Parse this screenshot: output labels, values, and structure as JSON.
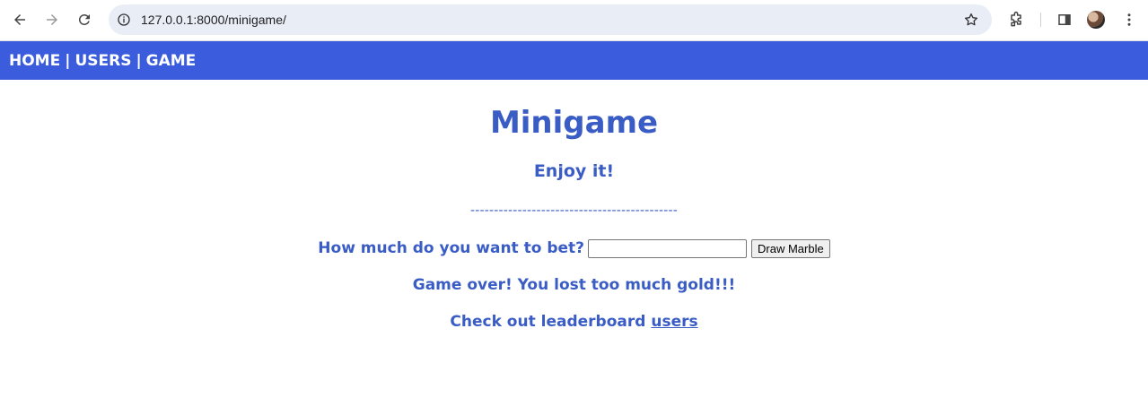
{
  "browser": {
    "url": "127.0.0.1:8000/minigame/",
    "icons": {
      "back": "back-arrow-icon",
      "forward": "forward-arrow-icon",
      "reload": "reload-icon",
      "site_info": "info-icon",
      "bookmark": "star-icon",
      "extensions": "puzzle-icon",
      "side_panel": "side-panel-icon",
      "profile": "avatar",
      "menu": "kebab-menu-icon"
    }
  },
  "nav": {
    "home": "HOME",
    "users": "USERS",
    "game": "GAME",
    "separator": "|"
  },
  "main": {
    "title": "Minigame",
    "subtitle": "Enjoy it!",
    "divider": "--------------------------------------------",
    "bet_label": "How much do you want to bet?",
    "bet_value": "",
    "draw_button": "Draw Marble",
    "game_over": "Game over! You lost too much gold!!!",
    "leaderboard_text": "Check out leaderboard",
    "leaderboard_link": "users"
  },
  "colors": {
    "nav_bg": "#3a5cdd",
    "text_accent": "#3a5cc5"
  }
}
